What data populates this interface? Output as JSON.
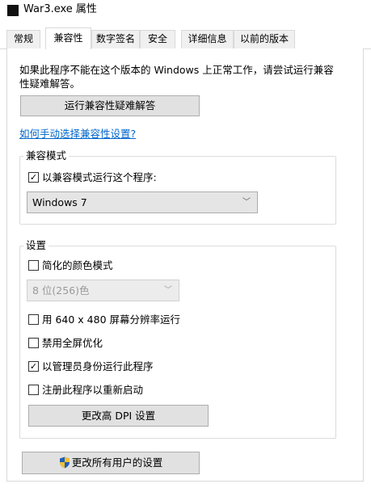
{
  "window": {
    "title": "War3.exe 属性",
    "icon": "app-icon"
  },
  "tabs": [
    {
      "label": "常规",
      "selected": false
    },
    {
      "label": "兼容性",
      "selected": true
    },
    {
      "label": "数字签名",
      "selected": false
    },
    {
      "label": "安全",
      "selected": false
    },
    {
      "label": "详细信息",
      "selected": false
    },
    {
      "label": "以前的版本",
      "selected": false
    }
  ],
  "compat": {
    "intro_line1": "如果此程序不能在这个版本的 Windows 上正常工作，请尝试运行兼容",
    "intro_line2": "性疑难解答。",
    "troubleshoot_button": "运行兼容性疑难解答",
    "manual_link": "如何手动选择兼容性设置?",
    "mode_group": {
      "legend": "兼容模式",
      "checkbox_label": "以兼容模式运行这个程序:",
      "checked": true,
      "os_selected": "Windows 7"
    },
    "settings_group": {
      "legend": "设置",
      "reduced_color_label": "简化的颜色模式",
      "reduced_color_checked": false,
      "color_depth_selected": "8 位(256)色",
      "color_depth_disabled": true,
      "resolution_label": "用 640 x 480 屏幕分辨率运行",
      "resolution_checked": false,
      "fullscreen_opt_label": "禁用全屏优化",
      "fullscreen_opt_checked": false,
      "admin_label": "以管理员身份运行此程序",
      "admin_checked": true,
      "register_restart_label": "注册此程序以重新启动",
      "register_restart_checked": false,
      "dpi_button": "更改高 DPI 设置"
    },
    "all_users_button": "更改所有用户的设置"
  },
  "colors": {
    "link": "#0066cc",
    "button_face": "#e1e1e1",
    "border": "#d9d9d9"
  }
}
